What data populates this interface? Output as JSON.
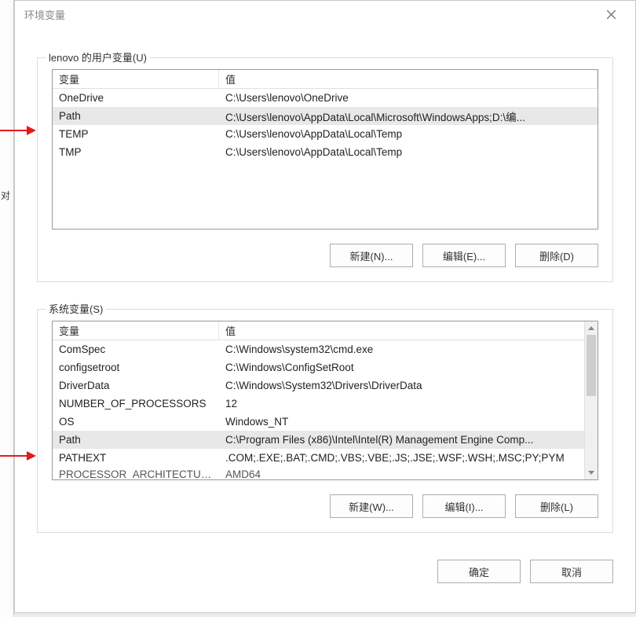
{
  "window": {
    "title": "环境变量",
    "close_tooltip": "关闭"
  },
  "user_section": {
    "label": "lenovo 的用户变量(U)",
    "header_var": "变量",
    "header_val": "值",
    "rows": [
      {
        "var": "OneDrive",
        "val": "C:\\Users\\lenovo\\OneDrive",
        "selected": false
      },
      {
        "var": "Path",
        "val": "C:\\Users\\lenovo\\AppData\\Local\\Microsoft\\WindowsApps;D:\\编...",
        "selected": true
      },
      {
        "var": "TEMP",
        "val": "C:\\Users\\lenovo\\AppData\\Local\\Temp",
        "selected": false
      },
      {
        "var": "TMP",
        "val": "C:\\Users\\lenovo\\AppData\\Local\\Temp",
        "selected": false
      }
    ],
    "btn_new": "新建(N)...",
    "btn_edit": "编辑(E)...",
    "btn_delete": "删除(D)"
  },
  "system_section": {
    "label": "系统变量(S)",
    "header_var": "变量",
    "header_val": "值",
    "rows": [
      {
        "var": "ComSpec",
        "val": "C:\\Windows\\system32\\cmd.exe",
        "selected": false
      },
      {
        "var": "configsetroot",
        "val": "C:\\Windows\\ConfigSetRoot",
        "selected": false
      },
      {
        "var": "DriverData",
        "val": "C:\\Windows\\System32\\Drivers\\DriverData",
        "selected": false
      },
      {
        "var": "NUMBER_OF_PROCESSORS",
        "val": "12",
        "selected": false
      },
      {
        "var": "OS",
        "val": "Windows_NT",
        "selected": false
      },
      {
        "var": "Path",
        "val": "C:\\Program Files (x86)\\Intel\\Intel(R) Management Engine Comp...",
        "selected": true
      },
      {
        "var": "PATHEXT",
        "val": ".COM;.EXE;.BAT;.CMD;.VBS;.VBE;.JS;.JSE;.WSF;.WSH;.MSC;PY;PYM",
        "selected": false
      },
      {
        "var": "PROCESSOR_ARCHITECTURE",
        "val": "AMD64",
        "selected": false,
        "partial": true
      }
    ],
    "btn_new": "新建(W)...",
    "btn_edit": "编辑(I)...",
    "btn_delete": "删除(L)"
  },
  "footer": {
    "ok": "确定",
    "cancel": "取消"
  },
  "left_partial": "对"
}
